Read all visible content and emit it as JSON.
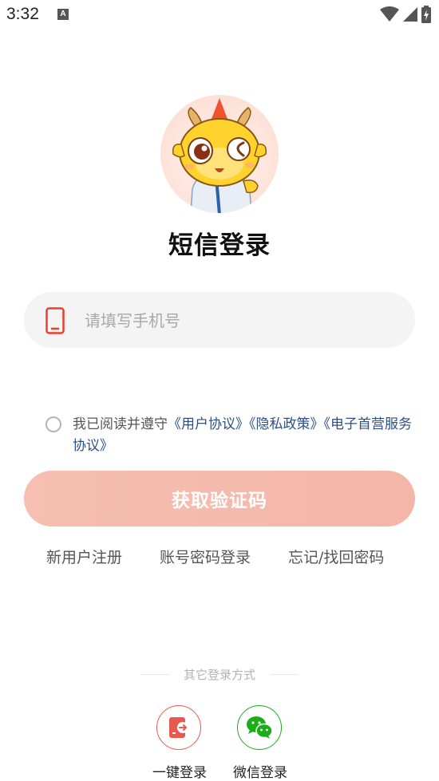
{
  "status_bar": {
    "time": "3:32",
    "notification_icon": "a-icon",
    "wifi_icon": "wifi-icon",
    "signal_icon": "signal-icon",
    "battery_icon": "battery-charging-icon"
  },
  "header": {
    "mascot": "dragon-mascot-avatar",
    "title": "短信登录"
  },
  "phone": {
    "placeholder": "请填写手机号",
    "value": "",
    "icon": "phone-icon"
  },
  "agreement": {
    "checked": false,
    "prefix": "我已阅读并遵守",
    "links": [
      "《用户协议》",
      "《隐私政策》",
      "《电子首营服务协议》"
    ]
  },
  "get_code_button": {
    "label": "获取验证码",
    "enabled": false
  },
  "links": {
    "register": "新用户注册",
    "password_login": "账号密码登录",
    "forgot_password": "忘记/找回密码"
  },
  "other_login": {
    "label": "其它登录方式",
    "options": [
      {
        "label": "一键登录",
        "icon": "one-key-login-icon",
        "color": "#e85a4f"
      },
      {
        "label": "微信登录",
        "icon": "wechat-icon",
        "color": "#1aad19"
      }
    ]
  },
  "colors": {
    "accent": "#f3b6a8",
    "link": "#2b4f86",
    "phone_icon": "#e8402f"
  }
}
